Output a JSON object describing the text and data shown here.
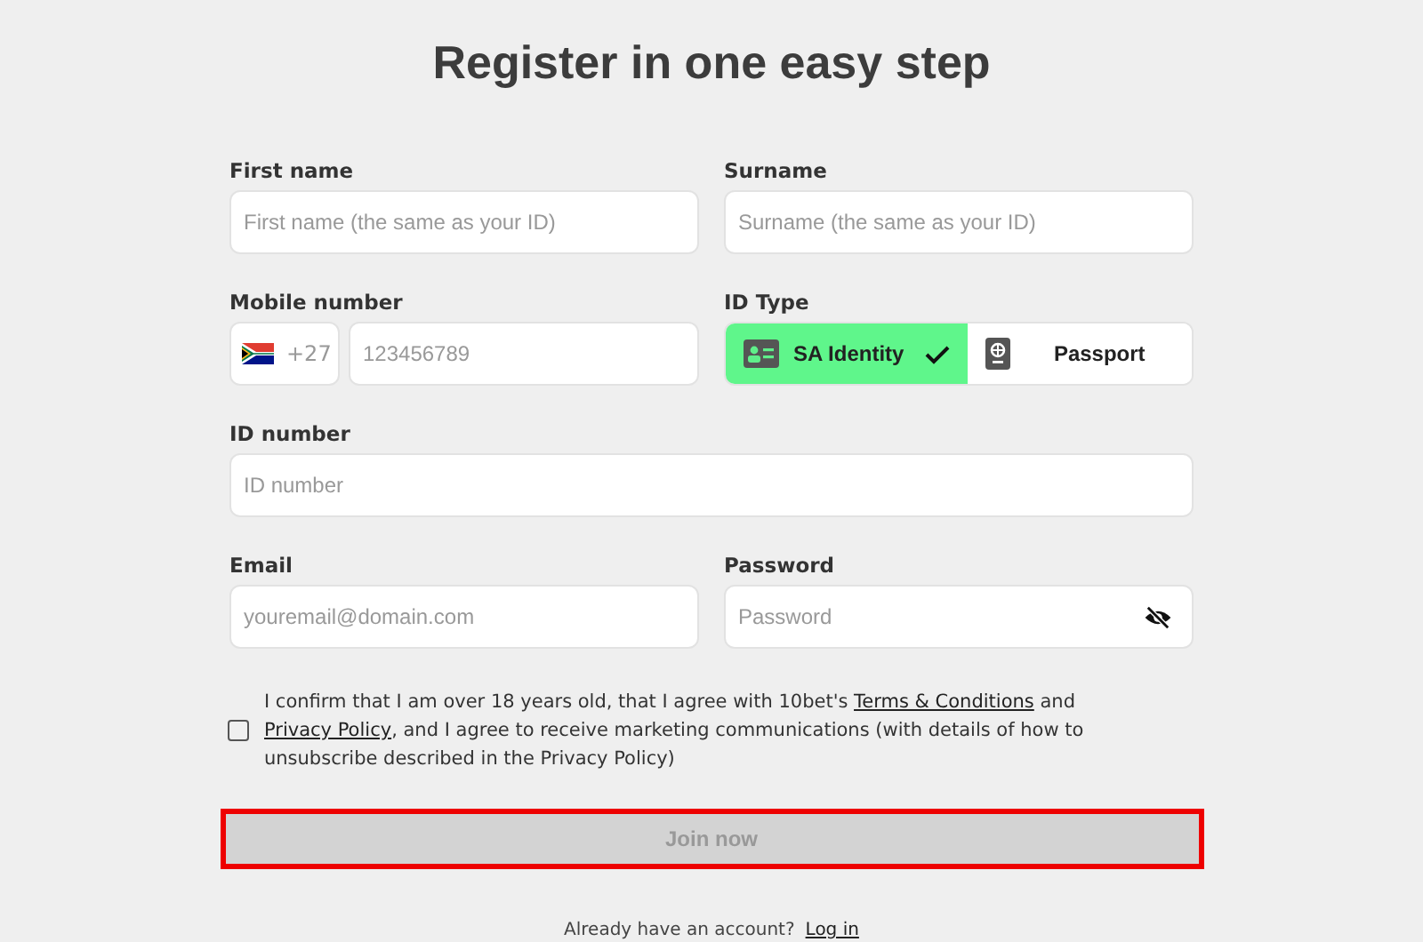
{
  "title": "Register in one easy step",
  "first_name": {
    "label": "First name",
    "placeholder": "First name (the same as your ID)"
  },
  "surname": {
    "label": "Surname",
    "placeholder": "Surname (the same as your ID)"
  },
  "mobile": {
    "label": "Mobile number",
    "country_code": "+27",
    "placeholder": "123456789"
  },
  "id_type": {
    "label": "ID Type",
    "options": [
      {
        "label": "SA Identity",
        "kind": "card",
        "selected": true
      },
      {
        "label": "Passport",
        "kind": "passport",
        "selected": false
      }
    ]
  },
  "id_number": {
    "label": "ID number",
    "placeholder": "ID number"
  },
  "email": {
    "label": "Email",
    "placeholder": "youremail@domain.com"
  },
  "password": {
    "label": "Password",
    "placeholder": "Password"
  },
  "consent": {
    "checked": false,
    "parts": [
      {
        "kind": "text",
        "text": "I confirm that I am over 18 years old, that I agree with 10bet's "
      },
      {
        "kind": "link",
        "text": "Terms & Conditions"
      },
      {
        "kind": "text",
        "text": " and "
      },
      {
        "kind": "link",
        "text": "Privacy Policy"
      },
      {
        "kind": "text",
        "text": ", and I agree to receive marketing communications (with details of how to unsubscribe described in the Privacy Policy)"
      }
    ]
  },
  "join_button": {
    "label": "Join now",
    "disabled": true,
    "highlighted": true
  },
  "login": {
    "prompt": "Already have an account?",
    "link": "Log in"
  }
}
